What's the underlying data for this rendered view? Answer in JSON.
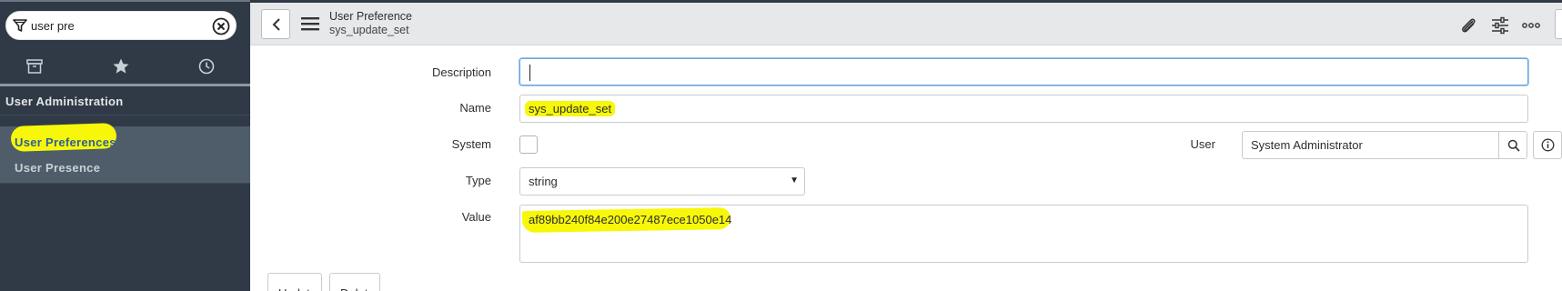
{
  "sidebar": {
    "filter_value": "user pre",
    "tabs": [
      {
        "icon": "archive-icon"
      },
      {
        "icon": "star-icon"
      },
      {
        "icon": "clock-icon"
      }
    ],
    "section_title": "User Administration",
    "modules": [
      {
        "label": "User Preferences",
        "active": true
      },
      {
        "label": "User Presence",
        "active": false
      }
    ]
  },
  "header": {
    "title": "User Preference",
    "subtitle": "sys_update_set",
    "icons": [
      "paperclip-icon",
      "sliders-icon",
      "more-icon"
    ]
  },
  "form": {
    "description": {
      "label": "Description",
      "value": ""
    },
    "name": {
      "label": "Name",
      "value": "sys_update_set"
    },
    "system": {
      "label": "System",
      "checked": false
    },
    "user": {
      "label": "User",
      "value": "System Administrator"
    },
    "type": {
      "label": "Type",
      "value": "string"
    },
    "value": {
      "label": "Value",
      "value": "af89bb240f84e200e27487ece1050e14"
    }
  },
  "buttons": {
    "update": "Update",
    "delete": "Delete"
  },
  "colors": {
    "sidebar_bg": "#303a46",
    "highlight": "#f7f709",
    "focus_border": "#6ea6db"
  }
}
